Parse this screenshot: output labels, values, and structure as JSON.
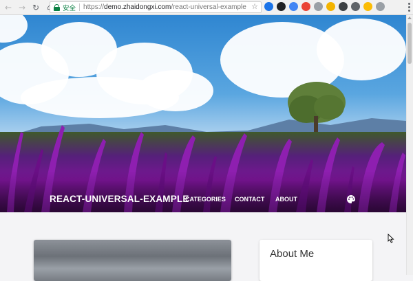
{
  "browser": {
    "secure_label": "安全",
    "url_scheme": "https://",
    "url_host": "demo.zhaidongxi.com",
    "url_path": "/react-universal-example",
    "extensions": [
      {
        "name": "extension-1-icon",
        "color": "#1a73e8"
      },
      {
        "name": "extension-2-icon",
        "color": "#202124"
      },
      {
        "name": "extension-3-icon",
        "color": "#4285f4"
      },
      {
        "name": "extension-4-icon",
        "color": "#ea4335"
      },
      {
        "name": "extension-5-icon",
        "color": "#9aa0a6"
      },
      {
        "name": "extension-6-icon",
        "color": "#f4b400"
      },
      {
        "name": "extension-7-icon",
        "color": "#3c4043"
      },
      {
        "name": "extension-8-icon",
        "color": "#5f6368"
      },
      {
        "name": "extension-9-icon",
        "color": "#fbbc04"
      },
      {
        "name": "extension-10-icon",
        "color": "#9aa0a6"
      }
    ]
  },
  "site": {
    "brand": "REACT-UNIVERSAL-EXAMPLE",
    "nav": [
      {
        "label": "CATEGORIES"
      },
      {
        "label": "CONTACT"
      },
      {
        "label": "ABOUT"
      }
    ],
    "theme_icon": "palette-icon"
  },
  "sidebar": {
    "about_title": "About Me"
  },
  "colors": {
    "hero_flowers": "#7a1596",
    "page_bg": "#f4f4f6",
    "secure_green": "#0b8043"
  }
}
